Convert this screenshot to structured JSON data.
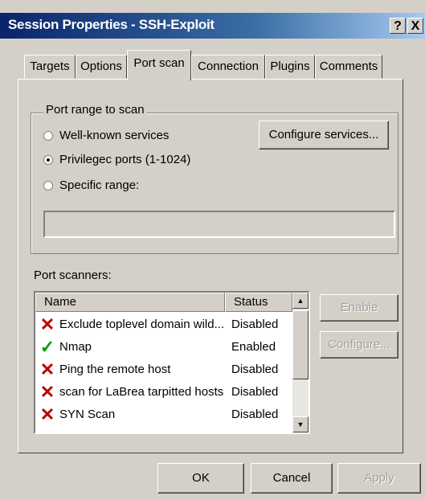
{
  "window": {
    "title": "Session Properties - SSH-Exploit",
    "help_label": "?",
    "close_label": "X"
  },
  "tabs": [
    {
      "label": "Targets"
    },
    {
      "label": "Options"
    },
    {
      "label": "Port scan"
    },
    {
      "label": "Connection"
    },
    {
      "label": "Plugins"
    },
    {
      "label": "Comments"
    }
  ],
  "active_tab": "Port scan",
  "port_range": {
    "group_label": "Port range to scan",
    "options": [
      {
        "label": "Well-known services",
        "selected": false
      },
      {
        "label": "Privilegec ports (1-1024)",
        "selected": true
      },
      {
        "label": "Specific range:",
        "selected": false
      }
    ],
    "range_value": "",
    "configure_label": "Configure services..."
  },
  "scanners": {
    "label": "Port scanners:",
    "columns": [
      "Name",
      "Status"
    ],
    "rows": [
      {
        "icon": "red-x-icon",
        "name": "Exclude toplevel domain wild...",
        "status": "Disabled"
      },
      {
        "icon": "green-check-icon",
        "name": "Nmap",
        "status": "Enabled"
      },
      {
        "icon": "red-x-icon",
        "name": "Ping the remote host",
        "status": "Disabled"
      },
      {
        "icon": "red-x-icon",
        "name": "scan for LaBrea tarpitted hosts",
        "status": "Disabled"
      },
      {
        "icon": "red-x-icon",
        "name": "SYN Scan",
        "status": "Disabled"
      }
    ],
    "enable_label": "Enable",
    "configure_label": "Configure..."
  },
  "footer": {
    "ok_label": "OK",
    "cancel_label": "Cancel",
    "apply_label": "Apply"
  },
  "colors": {
    "dialog_bg": "#d4d0c8",
    "title_start": "#0a246a",
    "title_end": "#a6caf0",
    "disabled_x": "#c00000",
    "enabled_check": "#00a000"
  }
}
